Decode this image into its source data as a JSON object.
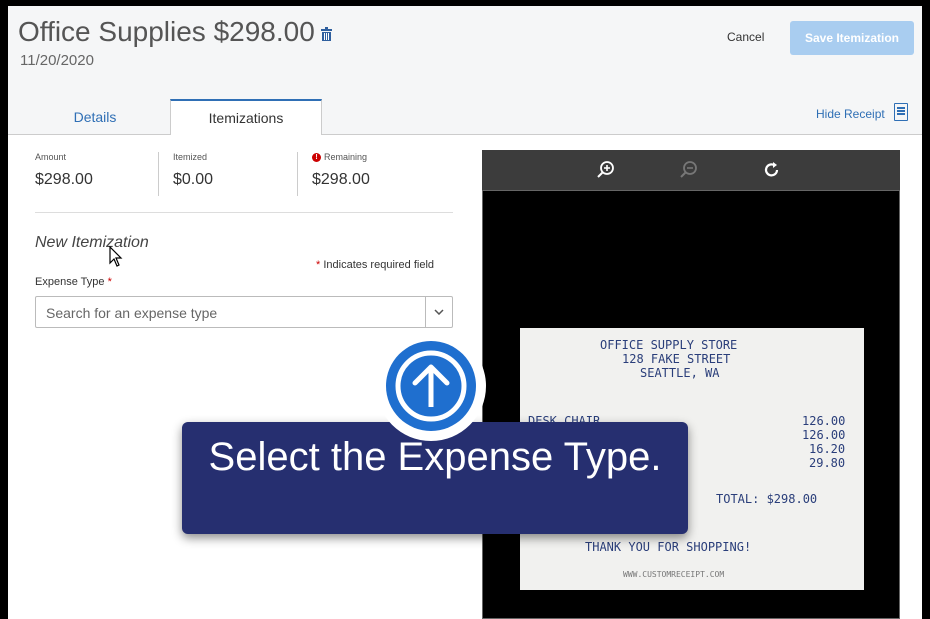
{
  "header": {
    "title": "Office Supplies $298.00",
    "date": "11/20/2020",
    "cancel_label": "Cancel",
    "save_label": "Save Itemization"
  },
  "tabs": [
    {
      "label": "Details",
      "active": false
    },
    {
      "label": "Itemizations",
      "active": true
    }
  ],
  "hide_receipt_label": "Hide Receipt",
  "summary": {
    "amount_label": "Amount",
    "amount_value": "$298.00",
    "itemized_label": "Itemized",
    "itemized_value": "$0.00",
    "remaining_label": "Remaining",
    "remaining_value": "$298.00"
  },
  "form": {
    "section_title": "New Itemization",
    "required_note": "Indicates required field",
    "required_star": "*",
    "expense_type_label": "Expense Type",
    "expense_type_placeholder": "Search for an expense type"
  },
  "receipt": {
    "store_name": "OFFICE SUPPLY STORE",
    "address": "128 FAKE STREET",
    "city": "SEATTLE, WA",
    "item_label": "DESK CHAIR",
    "amounts": [
      "126.00",
      "126.00",
      "16.20",
      "29.80"
    ],
    "total": "TOTAL: $298.00",
    "thanks": "THANK YOU FOR SHOPPING!",
    "website": "WWW.CUSTOMRECEIPT.COM"
  },
  "tutorial": {
    "instruction": "Select the Expense Type."
  },
  "colors": {
    "accent": "#2f6fb5",
    "save_button": "#a9cdf0",
    "overlay": "#262f70",
    "arrow_circle": "#1f6fcf",
    "required": "#cc0000"
  }
}
